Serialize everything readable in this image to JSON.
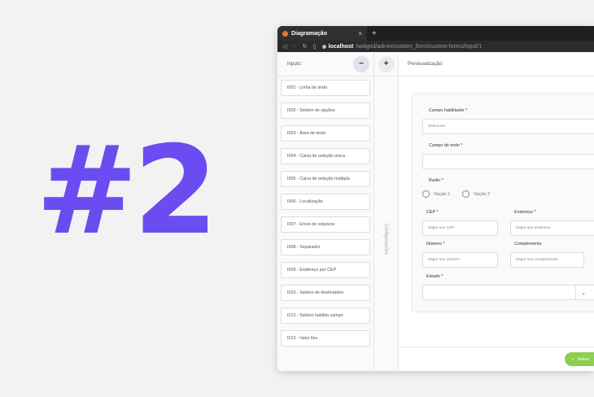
{
  "hero_text": "#2",
  "browser": {
    "tab_title": "Diagramação",
    "tab_close": "×",
    "new_tab": "+",
    "url_host": "localhost",
    "url_path": "/widgrid/admin/custom_form/custom-forms/input/1",
    "nav_icons": [
      "back-icon",
      "forward-icon",
      "reload-icon",
      "bookmark-icon"
    ]
  },
  "left_panel": {
    "label": "Inputs:",
    "minus_label": "−",
    "items": [
      "I001 - Linha de texto",
      "I002 - Seletor de opções",
      "I003 - Área de texto",
      "I004 - Caixa de seleção única",
      "I005 - Caixa de seleção múltipla",
      "I006 - Localização",
      "I007 - Envio de arquivos",
      "I008 - Separador",
      "I009 - Endereço por CEP",
      "I010 - Seletor de destinatário",
      "I012 - Seletor habilita campo",
      "I013 - Valor fixo"
    ]
  },
  "middle_panel": {
    "plus_label": "+",
    "vertical_label": "Configurações"
  },
  "preview": {
    "header": "Previsualização:",
    "campo_habilitador_label": "Campo habilitador *",
    "campo_habilitador_placeholder": "Selecione",
    "campo_texto_label": "Campo de texto *",
    "radio_label": "Radio *",
    "radio_option_1": "Opção 1",
    "radio_option_2": "Opção 2",
    "cep_label": "CEP *",
    "cep_placeholder": "Digite seu CEP",
    "endereco_label": "Endereço *",
    "endereco_placeholder": "Digite seu endereço",
    "numero_label": "Número *",
    "numero_placeholder": "Digite seu número",
    "complemento_label": "Complemento",
    "complemento_placeholder": "Digite seu complemento",
    "estado_label": "Estado *",
    "chevron": "⌄",
    "save_label": "Salvar"
  },
  "colors": {
    "hero": "#6a4cf0",
    "save_button": "#8bd04e"
  }
}
